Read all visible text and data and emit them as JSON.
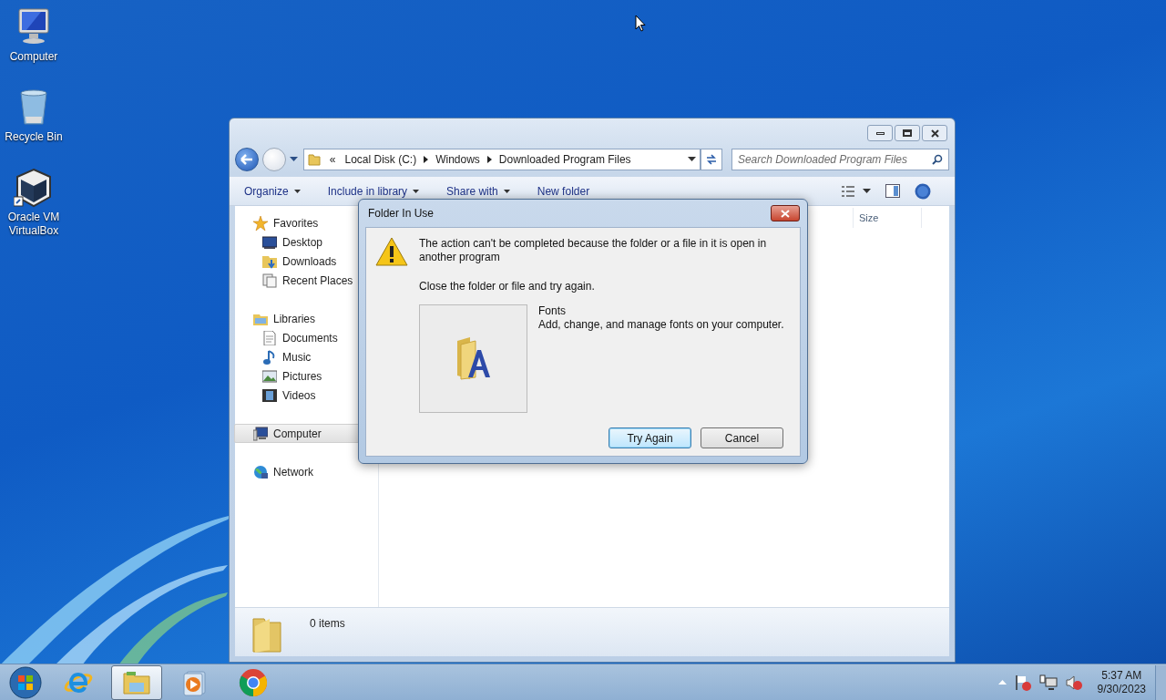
{
  "desktop_icons": [
    {
      "label": "Computer",
      "kind": "computer"
    },
    {
      "label": "Recycle Bin",
      "kind": "bin"
    },
    {
      "label": "Oracle VM VirtualBox",
      "kind": "box"
    }
  ],
  "explorer": {
    "back_enabled": true,
    "forward_enabled": false,
    "address": {
      "overflow": "«",
      "crumbs": [
        "Local Disk (C:)",
        "Windows",
        "Downloaded Program Files"
      ]
    },
    "search": {
      "placeholder": "Search Downloaded Program Files"
    },
    "toolbar": [
      {
        "label": "Organize",
        "has_menu": true
      },
      {
        "label": "Include in library",
        "has_menu": true
      },
      {
        "label": "Share with",
        "has_menu": true
      },
      {
        "label": "New folder",
        "has_menu": false
      }
    ],
    "nav": [
      {
        "label": "Favorites",
        "kind": "star",
        "selected": false,
        "children": [
          {
            "label": "Desktop",
            "kind": "desktop",
            "selected": false
          },
          {
            "label": "Downloads",
            "kind": "downloads",
            "selected": false
          },
          {
            "label": "Recent Places",
            "kind": "recent",
            "selected": false
          }
        ]
      },
      {
        "label": "Libraries",
        "kind": "library",
        "selected": false,
        "children": [
          {
            "label": "Documents",
            "kind": "document",
            "selected": false
          },
          {
            "label": "Music",
            "kind": "music",
            "selected": false
          },
          {
            "label": "Pictures",
            "kind": "pictures",
            "selected": false
          },
          {
            "label": "Videos",
            "kind": "videos",
            "selected": false
          }
        ]
      },
      {
        "label": "Computer",
        "kind": "computer",
        "selected": true
      },
      {
        "label": "Network",
        "kind": "network",
        "selected": false
      }
    ],
    "columns": [
      "Size"
    ],
    "status_bar": {
      "count": "0 items"
    }
  },
  "dialog": {
    "title": "Folder In Use",
    "message": "The action can't be completed because the folder or a file in it is open in another program",
    "hint": "Close the folder or file and try again.",
    "item": {
      "name": "Fonts",
      "description": "Add, change, and manage fonts on your computer."
    },
    "buttons": [
      {
        "label": "Try Again",
        "default": true
      },
      {
        "label": "Cancel",
        "default": false
      }
    ]
  },
  "taskbar": {
    "items": [
      {
        "kind": "ie",
        "selected": false
      },
      {
        "kind": "explorer",
        "selected": true
      },
      {
        "kind": "media",
        "selected": false
      },
      {
        "kind": "chrome",
        "selected": false
      }
    ],
    "clock": {
      "time": "5:37 AM",
      "date": "9/30/2023"
    }
  }
}
